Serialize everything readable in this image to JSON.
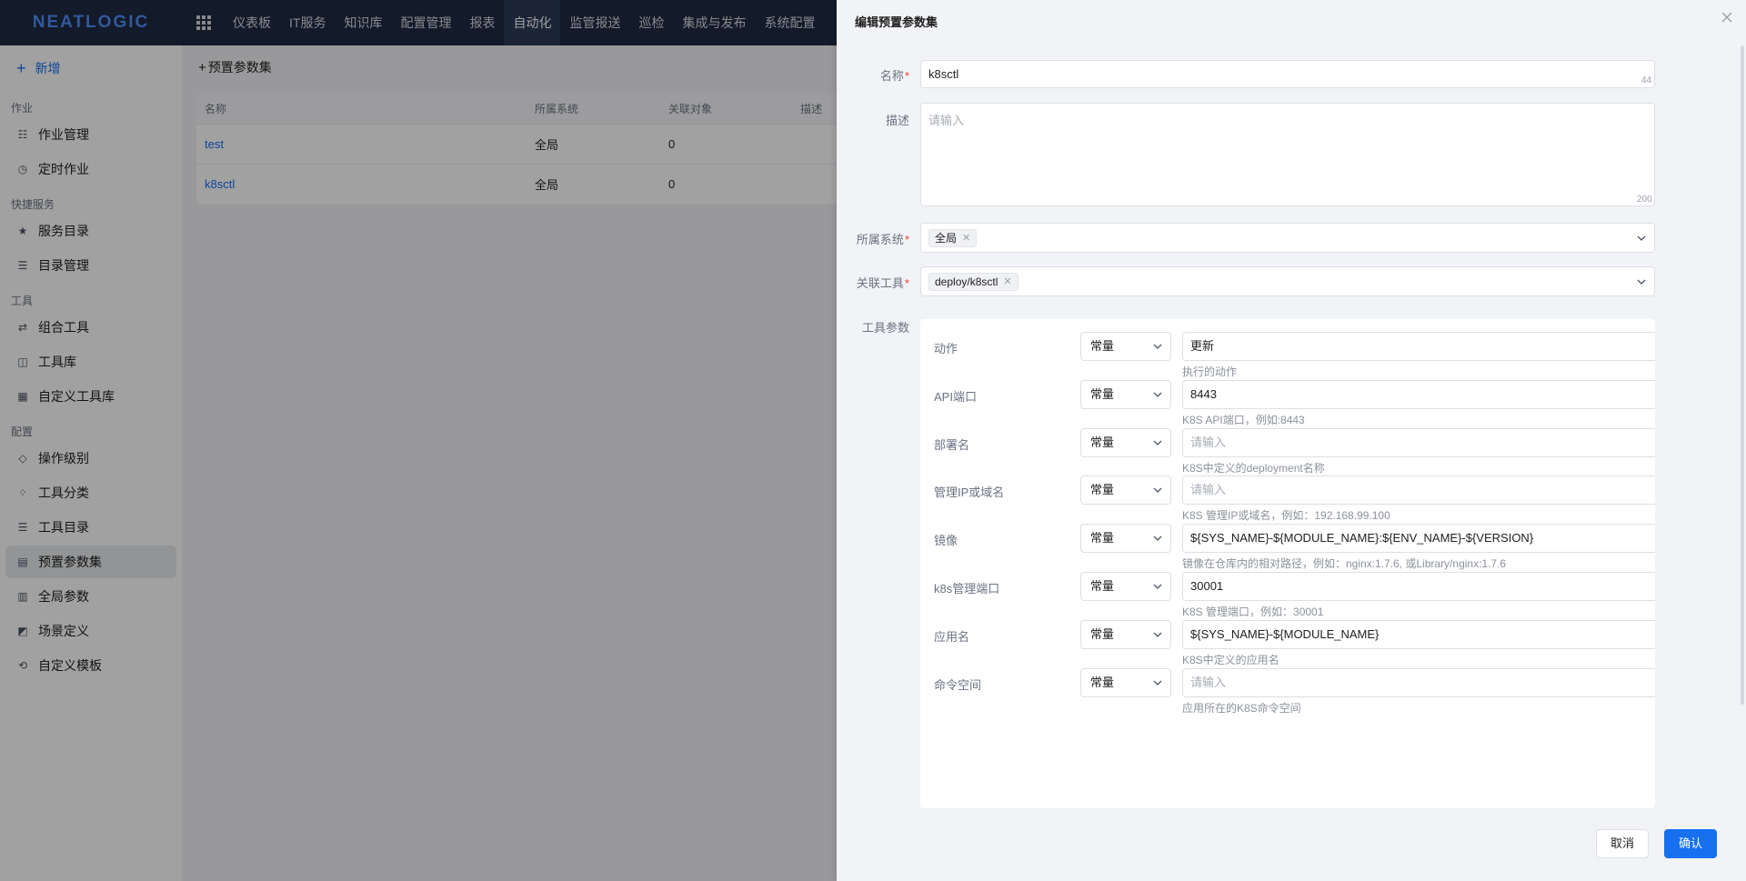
{
  "topbar": {
    "logo": "NEATLOGIC",
    "nav": [
      "仪表板",
      "IT服务",
      "知识库",
      "配置管理",
      "报表",
      "自动化",
      "监管报送",
      "巡检",
      "集成与发布",
      "系统配置"
    ],
    "active_index": 5
  },
  "sidebar": {
    "add_label": "新增",
    "groups": [
      {
        "title": "作业",
        "items": [
          "作业管理",
          "定时作业"
        ]
      },
      {
        "title": "快捷服务",
        "items": [
          "服务目录",
          "目录管理"
        ]
      },
      {
        "title": "工具",
        "items": [
          "组合工具",
          "工具库",
          "自定义工具库"
        ]
      },
      {
        "title": "配置",
        "items": [
          "操作级别",
          "工具分类",
          "工具目录",
          "预置参数集",
          "全局参数",
          "场景定义",
          "自定义模板"
        ]
      }
    ],
    "active_item": "预置参数集"
  },
  "main": {
    "action_label": "预置参数集",
    "table": {
      "headers": [
        "名称",
        "所属系统",
        "关联对象",
        "描述"
      ],
      "rows": [
        {
          "name": "test",
          "system": "全局",
          "target": "0"
        },
        {
          "name": "k8sctl",
          "system": "全局",
          "target": "0"
        }
      ]
    }
  },
  "drawer": {
    "title": "编辑预置参数集",
    "name_label": "名称",
    "name_value": "k8sctl",
    "name_counter": "44",
    "desc_label": "描述",
    "desc_placeholder": "请输入",
    "desc_counter": "200",
    "system_label": "所属系统",
    "system_tag": "全局",
    "tool_label": "关联工具",
    "tool_tag": "deploy/k8sctl",
    "params_label": "工具参数",
    "params": [
      {
        "label": "动作",
        "type": "常量",
        "value": "更新",
        "placeholder": "",
        "hint": "执行的动作",
        "select": true
      },
      {
        "label": "API端口",
        "type": "常量",
        "value": "8443",
        "placeholder": "",
        "hint": "K8S API端口，例如:8443",
        "select": false
      },
      {
        "label": "部署名",
        "type": "常量",
        "value": "",
        "placeholder": "请输入",
        "hint": "K8S中定义的deployment名称",
        "select": false
      },
      {
        "label": "管理IP或域名",
        "type": "常量",
        "value": "",
        "placeholder": "请输入",
        "hint": "K8S 管理IP或域名，例如：192.168.99.100",
        "select": false
      },
      {
        "label": "镜像",
        "type": "常量",
        "value": "${SYS_NAME}-${MODULE_NAME}:${ENV_NAME}-${VERSION}",
        "placeholder": "",
        "hint": "镜像在仓库内的相对路径，例如：nginx:1.7.6, 或Library/nginx:1.7.6",
        "select": false
      },
      {
        "label": "k8s管理端口",
        "type": "常量",
        "value": "30001",
        "placeholder": "",
        "hint": "K8S 管理端口，例如：30001",
        "select": false
      },
      {
        "label": "应用名",
        "type": "常量",
        "value": "${SYS_NAME}-${MODULE_NAME}",
        "placeholder": "",
        "hint": "K8S中定义的应用名",
        "select": false
      },
      {
        "label": "命令空间",
        "type": "常量",
        "value": "",
        "placeholder": "请输入",
        "hint": "应用所在的K8S命令空间",
        "select": false
      }
    ],
    "cancel_label": "取消",
    "ok_label": "确认"
  },
  "colors": {
    "accent": "#1670f0",
    "topbar": "#1f2a41",
    "required": "#f04134"
  }
}
